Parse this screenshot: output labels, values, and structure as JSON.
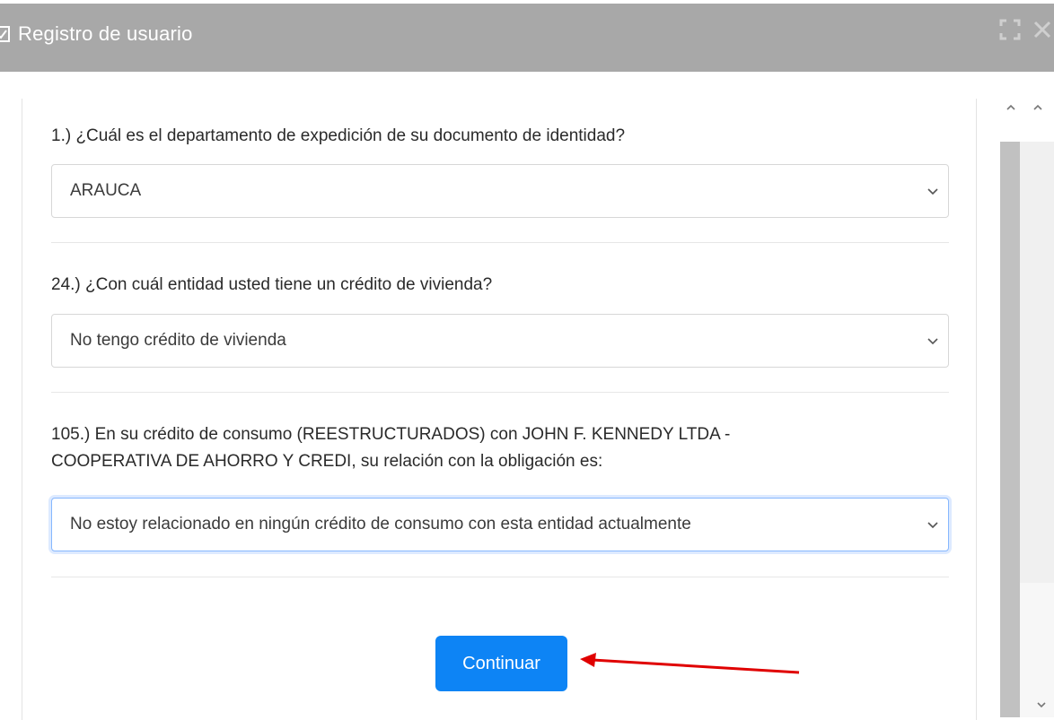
{
  "dialog": {
    "title": "Registro de usuario",
    "icons": {
      "title_icon": "checkbox-icon",
      "maximize": "maximize-icon",
      "close": "close-icon"
    }
  },
  "questions": [
    {
      "label": "1.) ¿Cuál es el departamento de expedición de su documento de identidad?",
      "selected": "ARAUCA"
    },
    {
      "label": "24.) ¿Con cuál entidad usted tiene un crédito de vivienda?",
      "selected": "No tengo crédito de vivienda"
    },
    {
      "label_line1": "105.) En su crédito de consumo (REESTRUCTURADOS) con JOHN F. KENNEDY LTDA -",
      "label_line2": "COOPERATIVA DE AHORRO Y CREDI, su relación con la obligación es:",
      "selected": "No estoy relacionado en ningún crédito de consumo con esta entidad actualmente"
    }
  ],
  "actions": {
    "continue_label": "Continuar"
  },
  "colors": {
    "header_bg": "#a8a8a8",
    "primary_button": "#0d84f5",
    "annotation_arrow": "#e00000"
  }
}
